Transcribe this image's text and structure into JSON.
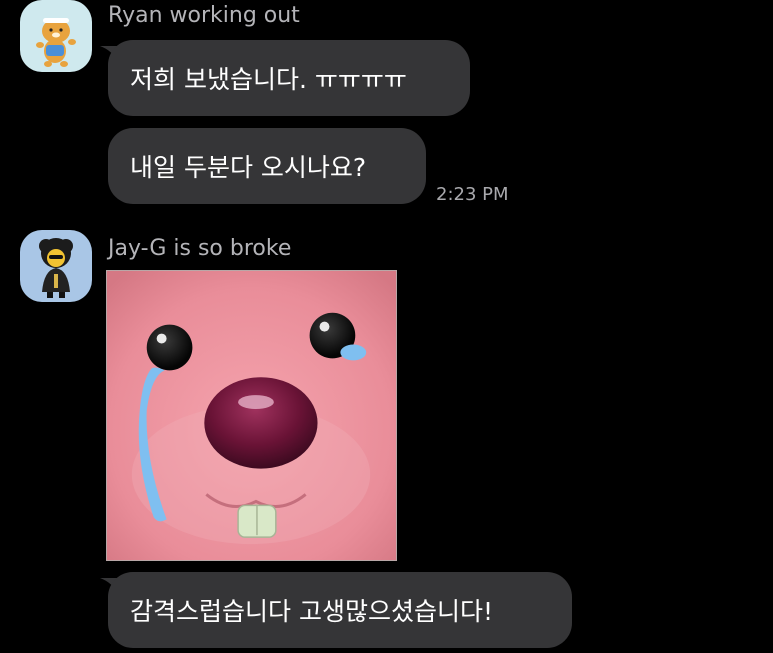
{
  "chat": {
    "groups": [
      {
        "sender": "Ryan working out",
        "avatar_icon": "ryan-lion-avatar-icon",
        "messages": [
          {
            "text": "저희 보냈습니다. ㅠㅠㅠㅠ"
          },
          {
            "text": "내일 두분다 오시나요?"
          }
        ],
        "timestamp": "2:23 PM"
      },
      {
        "sender": "Jay-G is so broke",
        "avatar_icon": "jay-g-character-avatar-icon",
        "sticker_icon": "crying-pink-beaver-sticker-icon",
        "messages": [
          {
            "text": "감격스럽습니다 고생많으셨습니다!"
          }
        ]
      }
    ]
  },
  "colors": {
    "background": "#000000",
    "bubble": "#353537",
    "sender_name": "#b4b4b8",
    "timestamp": "#a9a9ad",
    "message_text": "#ffffff"
  }
}
